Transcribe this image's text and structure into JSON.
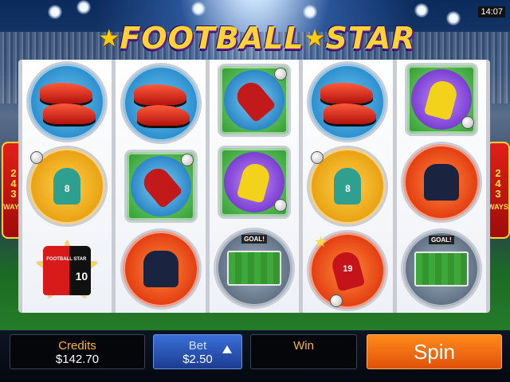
{
  "status": {
    "time": "14:07"
  },
  "logo": {
    "word1": "F",
    "ball": "O",
    "word2": "OTBALL",
    "word3": "STAR"
  },
  "side_badge": {
    "left_number_lines": [
      "2",
      "4",
      "3"
    ],
    "left_ways": "WAYS",
    "right_number_lines": [
      "2",
      "4",
      "3"
    ],
    "right_ways": "WAYS"
  },
  "reels": [
    [
      "football-boots-icon",
      "player-number-8-icon",
      "football-star-shirt-icon"
    ],
    [
      "football-boots-icon",
      "bicycle-kick-player-icon",
      "referee-icon"
    ],
    [
      "bicycle-kick-player-icon",
      "yellow-player-kicking-icon",
      "goal-stadium-icon"
    ],
    [
      "football-boots-icon",
      "player-number-8-icon",
      "player-number-19-icon"
    ],
    [
      "yellow-player-kicking-icon",
      "referee-icon",
      "goal-stadium-icon"
    ]
  ],
  "symbol_text": {
    "shirt_brand": "FOOTBALL STAR",
    "shirt_number": "10",
    "goal": "GOAL!",
    "number_8": "8",
    "number_19": "19"
  },
  "controls": {
    "credits_label": "Credits",
    "credits_value": "$142.70",
    "bet_label": "Bet",
    "bet_value": "$2.50",
    "win_label": "Win",
    "win_value": "",
    "spin_label": "Spin"
  },
  "colors": {
    "accent": "#ffb52e",
    "spin": "#f06a10",
    "bet": "#2a55b8"
  }
}
